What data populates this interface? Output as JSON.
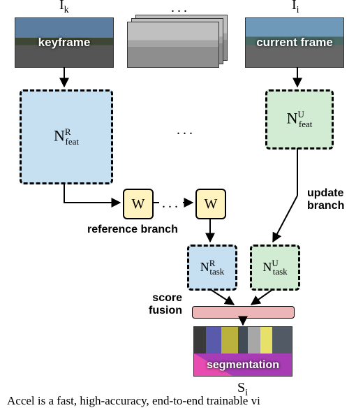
{
  "top": {
    "left_label": "I",
    "left_sub": "k",
    "right_label": "I",
    "right_sub": "i",
    "mid_dots": "..."
  },
  "frames": {
    "keyframe_label": "keyframe",
    "current_label": "current frame"
  },
  "boxes": {
    "nr_feat_main": "N",
    "nr_feat_sup": "R",
    "nr_feat_sub": "feat",
    "nu_feat_main": "N",
    "nu_feat_sup": "U",
    "nu_feat_sub": "feat",
    "w_label": "W",
    "nr_task_main": "N",
    "nr_task_sup": "R",
    "nr_task_sub": "task",
    "nu_task_main": "N",
    "nu_task_sup": "U",
    "nu_task_sub": "task"
  },
  "labels": {
    "reference_branch": "reference branch",
    "update_branch_1": "update",
    "update_branch_2": "branch",
    "score_fusion_1": "score",
    "score_fusion_2": "fusion",
    "segmentation": "segmentation",
    "bottom_label": "S",
    "bottom_sub": "i",
    "mid_feat_dots": "...",
    "mid_w_dots": "..."
  },
  "caption_fragment": "Accel is a fast, high-accuracy, end-to-end trainable vi"
}
